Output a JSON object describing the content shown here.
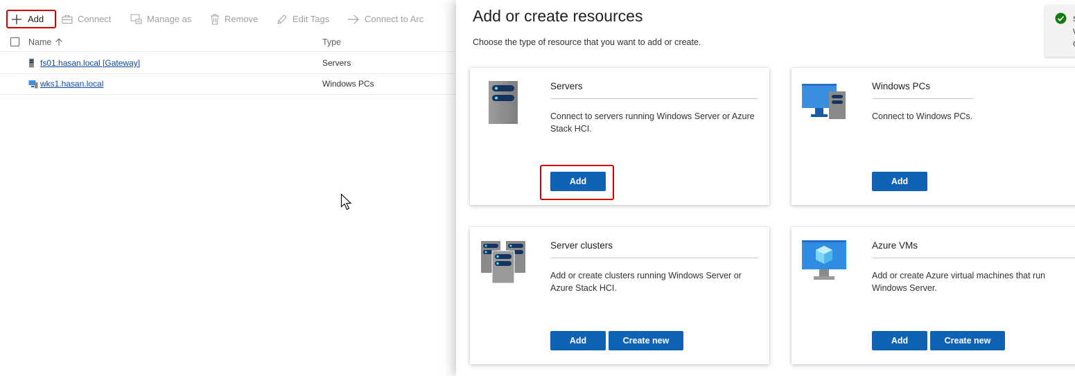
{
  "toolbar": {
    "add": "Add",
    "connect": "Connect",
    "manage_as": "Manage as",
    "remove": "Remove",
    "edit_tags": "Edit Tags",
    "connect_arc": "Connect to Arc"
  },
  "table": {
    "columns": [
      "Name",
      "Type"
    ],
    "rows": [
      {
        "name": "fs01.hasan.local [Gateway]",
        "type": "Servers",
        "icon": "server-icon"
      },
      {
        "name": "wks1.hasan.local",
        "type": "Windows PCs",
        "icon": "pc-icon"
      }
    ]
  },
  "panel": {
    "title": "Add or create resources",
    "subtitle": "Choose the type of resource that you want to add or create.",
    "cards": [
      {
        "title": "Servers",
        "desc": "Connect to servers running Windows Server or Azure Stack HCI.",
        "add": "Add"
      },
      {
        "title": "Windows PCs",
        "desc": "Connect to Windows PCs.",
        "add": "Add"
      },
      {
        "title": "Server clusters",
        "desc": "Add or create clusters running Windows Server or Azure Stack HCI.",
        "add": "Add",
        "create": "Create new"
      },
      {
        "title": "Azure VMs",
        "desc": "Add or create Azure virtual machines that run Windows Server.",
        "add": "Add",
        "create": "Create new"
      }
    ]
  },
  "toast": {
    "line1": "S",
    "line2": "W",
    "line3": "C"
  },
  "colors": {
    "accent": "#0f62b4",
    "highlight": "#d00000",
    "success": "#107c10"
  }
}
